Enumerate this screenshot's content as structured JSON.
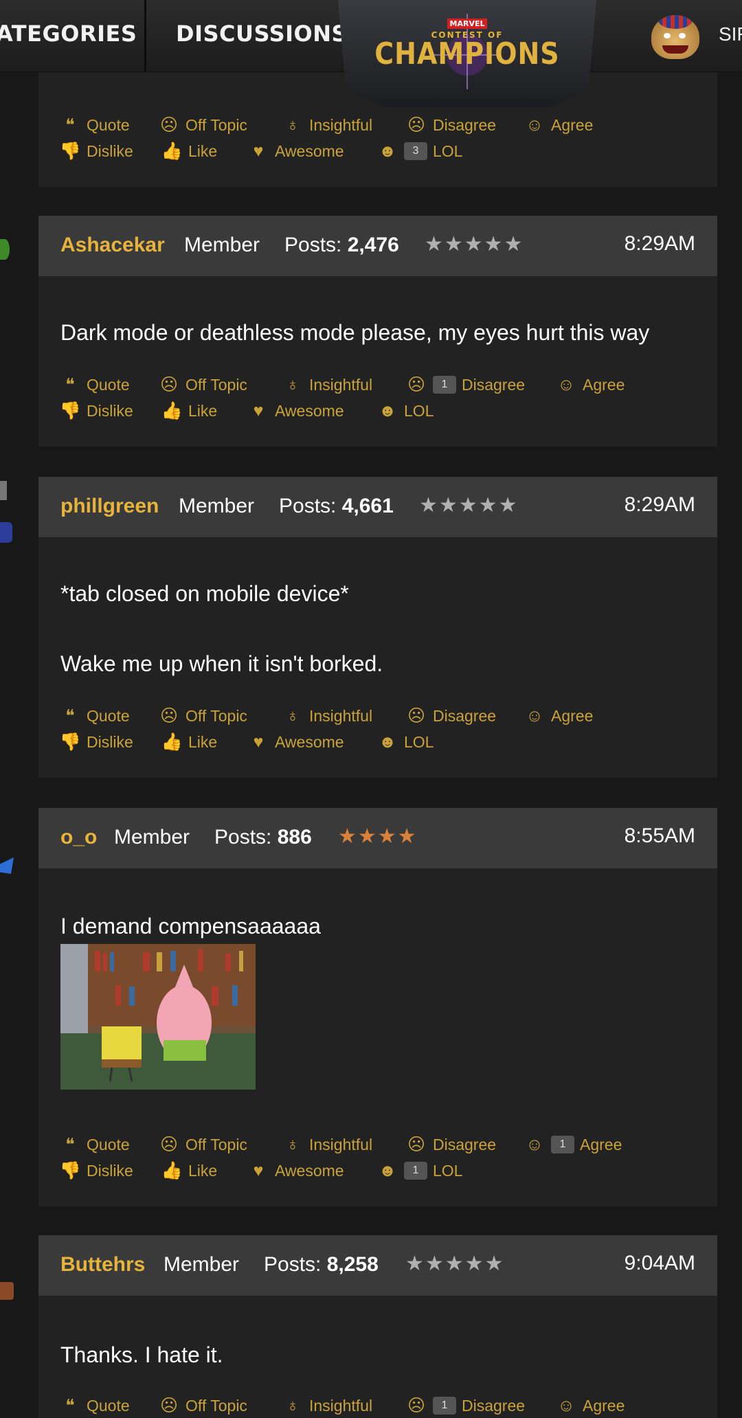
{
  "nav": {
    "categories": "ATEGORIES",
    "discussions": "DISCUSSIONS",
    "user": "SIR"
  },
  "logo": {
    "line1": "MARVEL",
    "line2": "CONTEST OF",
    "line3": "CHAMPIONS"
  },
  "colors": {
    "accent": "#c9a33a",
    "author": "#e6b43c",
    "star_grey": "#b0b0b0",
    "star_bronze": "#d9803a"
  },
  "reaction_labels": {
    "quote": "Quote",
    "off_topic": "Off Topic",
    "insightful": "Insightful",
    "disagree": "Disagree",
    "agree": "Agree",
    "dislike": "Dislike",
    "like": "Like",
    "awesome": "Awesome",
    "lol": "LOL"
  },
  "posts": [
    {
      "reaction_counts": {
        "lol": "3"
      }
    },
    {
      "author": "Ashacekar",
      "role": "Member",
      "posts_label": "Posts:",
      "posts_count": "2,476",
      "stars": "★★★★★",
      "time": "8:29AM",
      "body": [
        "Dark mode or deathless mode please, my eyes hurt this way"
      ],
      "reaction_counts": {
        "disagree": "1"
      }
    },
    {
      "author": "phillgreen",
      "role": "Member",
      "posts_label": "Posts:",
      "posts_count": "4,661",
      "stars": "★★★★★",
      "time": "8:29AM",
      "body": [
        "*tab closed on mobile device*",
        "Wake me up when it isn't borked."
      ],
      "reaction_counts": {}
    },
    {
      "author": "o_o",
      "role": "Member",
      "posts_label": "Posts:",
      "posts_count": "886",
      "stars": "★★★★",
      "time": "8:55AM",
      "body": [
        "I demand compensaaaaaa"
      ],
      "reaction_counts": {
        "agree": "1",
        "lol": "1"
      }
    },
    {
      "author": "Buttehrs",
      "role": "Member",
      "posts_label": "Posts:",
      "posts_count": "8,258",
      "stars": "★★★★★",
      "time": "9:04AM",
      "body": [
        "Thanks. I hate it."
      ],
      "reaction_counts": {
        "disagree": "1"
      }
    }
  ]
}
